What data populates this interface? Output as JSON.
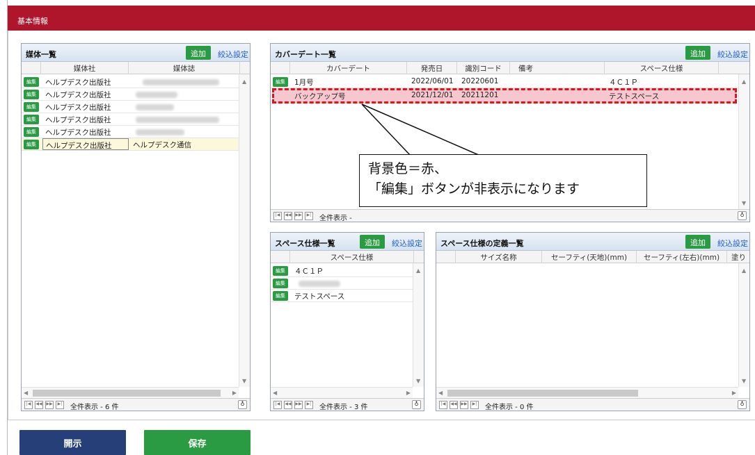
{
  "title": "基本情報",
  "media_panel": {
    "title": "媒体一覧",
    "add_label": "追加",
    "filter_label": "絞込設定",
    "columns": [
      "媒体社",
      "媒体誌"
    ],
    "rows": [
      {
        "edit": "編集",
        "company": "ヘルプデスク出版社",
        "magazine": ""
      },
      {
        "edit": "編集",
        "company": "ヘルプデスク出版社",
        "magazine": ""
      },
      {
        "edit": "編集",
        "company": "ヘルプデスク出版社",
        "magazine": ""
      },
      {
        "edit": "編集",
        "company": "ヘルプデスク出版社",
        "magazine": ""
      },
      {
        "edit": "編集",
        "company": "ヘルプデスク出版社",
        "magazine": ""
      },
      {
        "edit": "編集",
        "company": "ヘルプデスク出版社",
        "magazine": "ヘルプデスク通信"
      }
    ],
    "status": "全件表示 - 6 件"
  },
  "cover_panel": {
    "title": "カバーデート一覧",
    "add_label": "追加",
    "filter_label": "絞込設定",
    "columns": [
      "カバーデート",
      "発売日",
      "識別コード",
      "備考",
      "スペース仕様"
    ],
    "rows": [
      {
        "edit": "編集",
        "cover_date": "1月号",
        "release": "2022/06/01",
        "code": "20220601",
        "note": "",
        "space": "４Ｃ１Ｐ"
      },
      {
        "edit": "",
        "cover_date": "バックアップ号",
        "release": "2021/12/01",
        "code": "20211201",
        "note": "",
        "space": "テストスペース"
      }
    ],
    "status": "全件表示 -"
  },
  "space_panel": {
    "title": "スペース仕様一覧",
    "add_label": "追加",
    "filter_label": "絞込設定",
    "columns": [
      "スペース仕様"
    ],
    "rows": [
      {
        "edit": "編集",
        "name": "４Ｃ１Ｐ"
      },
      {
        "edit": "編集",
        "name": ""
      },
      {
        "edit": "編集",
        "name": "テストスペース"
      }
    ],
    "status": "全件表示 - 3 件"
  },
  "definition_panel": {
    "title": "スペース仕様の定義一覧",
    "add_label": "追加",
    "filter_label": "絞込設定",
    "columns": [
      "サイズ名称",
      "セーフティ(天地)(mm)",
      "セーフティ(左右)(mm)",
      "塗り"
    ],
    "status": "全件表示 - 0 件"
  },
  "callout": {
    "line1": "背景色＝赤、",
    "line2": "「編集」ボタンが非表示になります"
  },
  "footer": {
    "publish_label": "開示",
    "save_label": "保存"
  },
  "colors": {
    "brand": "#b0162b",
    "add_button": "#2a9b43",
    "publish_button": "#263f78",
    "save_button": "#2a9b43",
    "highlight_fill": "#f6c7cd",
    "highlight_border": "#e0131f"
  }
}
